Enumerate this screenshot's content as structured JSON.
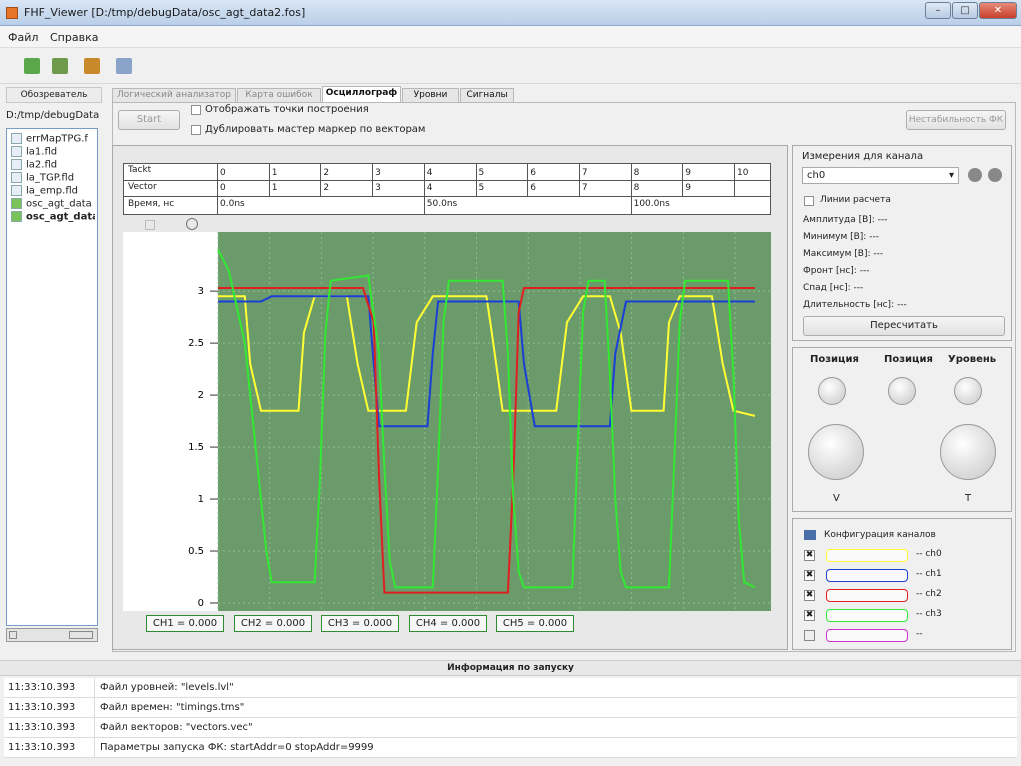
{
  "window": {
    "title": "FHF_Viewer [D:/tmp/debugData/osc_agt_data2.fos]"
  },
  "menu": {
    "file": "Файл",
    "help": "Справка"
  },
  "left_panel": {
    "tab": "Обозреватель",
    "path": "D:/tmp/debugData",
    "files": [
      "errMapTPG.f",
      "la1.fld",
      "la2.fld",
      "la_TGP.fld",
      "la_emp.fld",
      "osc_agt_data",
      "osc_agt_data"
    ]
  },
  "tabs": [
    "Логический анализатор",
    "Карта ошибок",
    "Осциллограф",
    "Уровни",
    "Сигналы"
  ],
  "controls": {
    "start": "Start",
    "show_points": "Отображать точки построения",
    "dup_marker": "Дублировать мастер маркер по векторам",
    "instability": "Нестабильность ФК"
  },
  "grid": {
    "tackt_label": "Tackt",
    "vector_label": "Vector",
    "time_label": "Время, нс",
    "tackt": [
      "0",
      "1",
      "2",
      "3",
      "4",
      "5",
      "6",
      "7",
      "8",
      "9",
      "10"
    ],
    "vector": [
      "0",
      "1",
      "2",
      "3",
      "4",
      "5",
      "6",
      "7",
      "8",
      "9"
    ],
    "time": [
      "0.0ns",
      "50.0ns",
      "100.0ns"
    ]
  },
  "chart_data": {
    "type": "line",
    "ylim": [
      0,
      3.5
    ],
    "xlim": [
      0,
      10.3
    ],
    "yticks": [
      "0",
      "0.5",
      "1",
      "1.5",
      "2",
      "2.5",
      "3"
    ],
    "colors": {
      "ch0": "#ffff33",
      "ch1": "#1a3fd6",
      "ch2": "#e02020",
      "ch3": "#33e833"
    },
    "series": [
      {
        "id": "ch0",
        "points": [
          [
            0,
            2.95
          ],
          [
            0.5,
            2.95
          ],
          [
            0.6,
            2.3
          ],
          [
            0.8,
            1.85
          ],
          [
            1.5,
            1.85
          ],
          [
            1.6,
            2.6
          ],
          [
            1.8,
            2.95
          ],
          [
            2.4,
            2.95
          ],
          [
            2.6,
            2.3
          ],
          [
            2.8,
            1.85
          ],
          [
            3.5,
            1.85
          ],
          [
            3.7,
            2.7
          ],
          [
            4,
            2.95
          ],
          [
            5,
            2.95
          ],
          [
            5.1,
            2.6
          ],
          [
            5.3,
            1.85
          ],
          [
            6.3,
            1.85
          ],
          [
            6.5,
            2.7
          ],
          [
            6.8,
            2.95
          ],
          [
            7.3,
            2.95
          ],
          [
            7.5,
            2.6
          ],
          [
            7.7,
            1.85
          ],
          [
            8.3,
            1.85
          ],
          [
            8.4,
            2.7
          ],
          [
            8.6,
            2.95
          ],
          [
            9.2,
            2.95
          ],
          [
            9.4,
            2.3
          ],
          [
            9.6,
            1.85
          ],
          [
            10,
            1.8
          ]
        ]
      },
      {
        "id": "ch1",
        "points": [
          [
            0,
            2.9
          ],
          [
            0.2,
            2.9
          ],
          [
            0.8,
            2.9
          ],
          [
            1,
            2.95
          ],
          [
            1.5,
            2.95
          ],
          [
            1.9,
            2.95
          ],
          [
            2.4,
            2.95
          ],
          [
            2.8,
            2.95
          ],
          [
            2.9,
            2.3
          ],
          [
            3,
            1.7
          ],
          [
            3.9,
            1.7
          ],
          [
            4,
            2.4
          ],
          [
            4.1,
            2.9
          ],
          [
            5.6,
            2.9
          ],
          [
            5.7,
            2.3
          ],
          [
            5.9,
            1.7
          ],
          [
            7.3,
            1.7
          ],
          [
            7.4,
            2.4
          ],
          [
            7.6,
            2.9
          ],
          [
            10,
            2.9
          ]
        ]
      },
      {
        "id": "ch2",
        "points": [
          [
            0,
            3.03
          ],
          [
            2.7,
            3.03
          ],
          [
            2.9,
            2.7
          ],
          [
            3,
            1.2
          ],
          [
            3.1,
            0.1
          ],
          [
            4,
            0.1
          ],
          [
            5.4,
            0.1
          ],
          [
            5.5,
            1.2
          ],
          [
            5.6,
            2.8
          ],
          [
            5.7,
            3.03
          ],
          [
            10,
            3.03
          ]
        ]
      },
      {
        "id": "ch3",
        "points": [
          [
            0,
            3.4
          ],
          [
            0.2,
            3.2
          ],
          [
            0.5,
            2.5
          ],
          [
            0.7,
            1.5
          ],
          [
            0.9,
            0.5
          ],
          [
            1,
            0.2
          ],
          [
            1.8,
            0.2
          ],
          [
            1.9,
            1.2
          ],
          [
            2,
            2.6
          ],
          [
            2.1,
            3.1
          ],
          [
            2.8,
            3.15
          ],
          [
            3,
            2.4
          ],
          [
            3.1,
            1.3
          ],
          [
            3.2,
            0.4
          ],
          [
            3.3,
            0.15
          ],
          [
            4,
            0.15
          ],
          [
            4.1,
            1.3
          ],
          [
            4.2,
            2.7
          ],
          [
            4.3,
            3.1
          ],
          [
            5.3,
            3.1
          ],
          [
            5.4,
            2.4
          ],
          [
            5.5,
            1
          ],
          [
            5.6,
            0.3
          ],
          [
            5.7,
            0.15
          ],
          [
            6.6,
            0.15
          ],
          [
            6.7,
            1.5
          ],
          [
            6.8,
            2.8
          ],
          [
            6.9,
            3.1
          ],
          [
            7.2,
            3.1
          ],
          [
            7.3,
            2.2
          ],
          [
            7.4,
            1
          ],
          [
            7.5,
            0.3
          ],
          [
            7.6,
            0.15
          ],
          [
            8.4,
            0.15
          ],
          [
            8.5,
            1.4
          ],
          [
            8.6,
            2.7
          ],
          [
            8.7,
            3.1
          ],
          [
            9.5,
            3.1
          ],
          [
            9.6,
            2.2
          ],
          [
            9.7,
            0.8
          ],
          [
            9.8,
            0.2
          ],
          [
            10,
            0.15
          ]
        ]
      }
    ]
  },
  "channel_values": [
    "CH1 = 0.000",
    "CH2 = 0.000",
    "CH3 = 0.000",
    "CH4 = 0.000",
    "CH5 = 0.000"
  ],
  "measure": {
    "title": "Измерения для канала",
    "channel": "ch0",
    "lines": "Линии расчета",
    "rows": [
      "Амплитуда [В]: ---",
      "Минимум [В]:  ---",
      "Максимум [В]:  ---",
      "Фронт [нс]:  ---",
      "Спад [нс]:  ---",
      "Длительность [нс]:  ---"
    ],
    "recalc": "Пересчитать"
  },
  "knobs": {
    "pos1": "Позиция",
    "pos2": "Позиция",
    "level": "Уровень",
    "v": "V",
    "t": "T"
  },
  "config": {
    "title": "Конфигурация каналов",
    "channels": [
      "-- ch0",
      "-- ch1",
      "-- ch2",
      "-- ch3",
      "--"
    ],
    "colors": [
      "#ffff33",
      "#1a3fd6",
      "#e02020",
      "#33e833",
      "#cc33cc"
    ]
  },
  "log": {
    "title": "Информация по запуску",
    "rows": [
      [
        "11:33:10.393",
        "Файл уровней: \"levels.lvl\""
      ],
      [
        "11:33:10.393",
        "Файл времен: \"timings.tms\""
      ],
      [
        "11:33:10.393",
        "Файл векторов: \"vectors.vec\""
      ],
      [
        "11:33:10.393",
        "Параметры запуска ФК: startAddr=0 stopAddr=9999"
      ]
    ]
  }
}
